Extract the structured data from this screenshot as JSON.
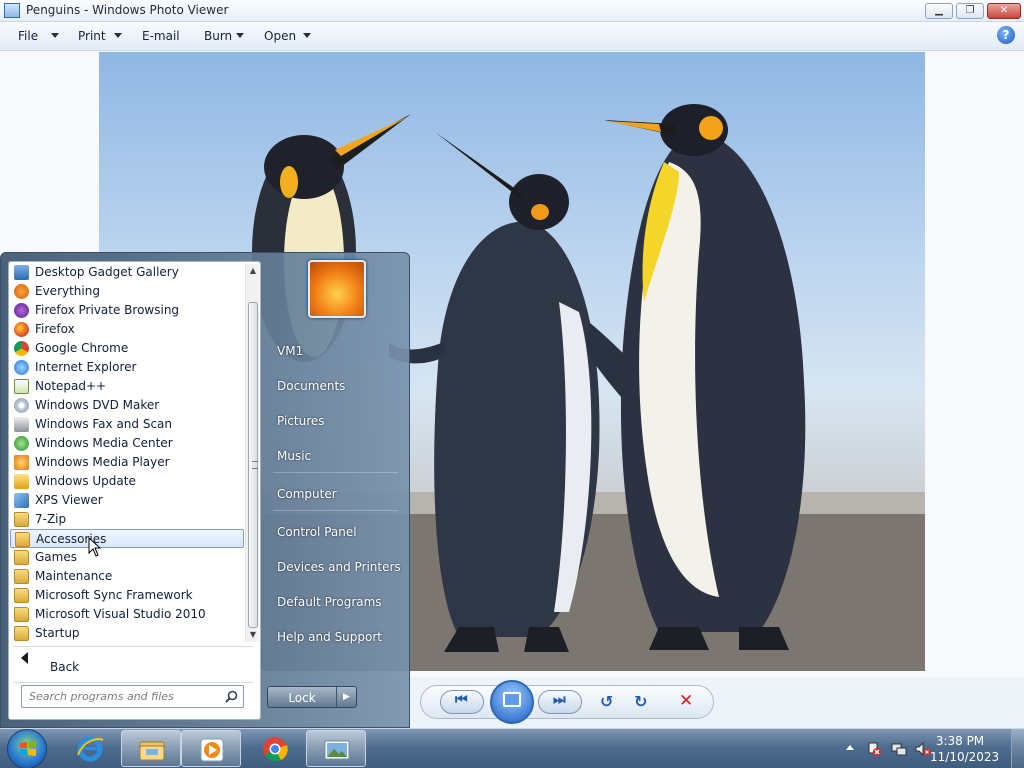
{
  "window": {
    "title": "Penguins - Windows Photo Viewer",
    "minimize_icon": "minimize-icon",
    "maximize_icon": "restore-icon",
    "close_icon": "close-icon"
  },
  "menubar": {
    "items": [
      {
        "label": "File",
        "has_dropdown": true
      },
      {
        "label": "Print",
        "has_dropdown": true
      },
      {
        "label": "E-mail",
        "has_dropdown": false
      },
      {
        "label": "Burn",
        "has_dropdown": true
      },
      {
        "label": "Open",
        "has_dropdown": true
      }
    ],
    "help": "?"
  },
  "viewer": {
    "image_subject": "penguins-photo",
    "controls": [
      "previous-icon",
      "slideshow-icon",
      "next-icon",
      "rotate-counterclockwise-icon",
      "rotate-clockwise-icon",
      "delete-icon"
    ]
  },
  "start_menu": {
    "programs": [
      {
        "label": "Desktop Gadget Gallery",
        "icon": "gadget-icon",
        "selected": false
      },
      {
        "label": "Everything",
        "icon": "everything-search-icon",
        "selected": false
      },
      {
        "label": "Firefox Private Browsing",
        "icon": "firefox-private-icon",
        "selected": false
      },
      {
        "label": "Firefox",
        "icon": "firefox-icon",
        "selected": false
      },
      {
        "label": "Google Chrome",
        "icon": "chrome-icon",
        "selected": false
      },
      {
        "label": "Internet Explorer",
        "icon": "internet-explorer-icon",
        "selected": false
      },
      {
        "label": "Notepad++",
        "icon": "notepadpp-icon",
        "selected": false
      },
      {
        "label": "Windows DVD Maker",
        "icon": "dvd-maker-icon",
        "selected": false
      },
      {
        "label": "Windows Fax and Scan",
        "icon": "fax-scan-icon",
        "selected": false
      },
      {
        "label": "Windows Media Center",
        "icon": "media-center-icon",
        "selected": false
      },
      {
        "label": "Windows Media Player",
        "icon": "media-player-icon",
        "selected": false
      },
      {
        "label": "Windows Update",
        "icon": "windows-update-icon",
        "selected": false
      },
      {
        "label": "XPS Viewer",
        "icon": "xps-viewer-icon",
        "selected": false
      },
      {
        "label": "7-Zip",
        "icon": "folder-icon",
        "selected": false
      },
      {
        "label": "Accessories",
        "icon": "folder-icon",
        "selected": true
      },
      {
        "label": "Games",
        "icon": "folder-icon",
        "selected": false
      },
      {
        "label": "Maintenance",
        "icon": "folder-icon",
        "selected": false
      },
      {
        "label": "Microsoft Sync Framework",
        "icon": "folder-icon",
        "selected": false
      },
      {
        "label": "Microsoft Visual Studio 2010",
        "icon": "folder-icon",
        "selected": false
      },
      {
        "label": "Startup",
        "icon": "folder-icon",
        "selected": false
      }
    ],
    "back_label": "Back",
    "search_placeholder": "Search programs and files",
    "right_items": [
      "VM1",
      "Documents",
      "Pictures",
      "Music",
      "Computer",
      "Control Panel",
      "Devices and Printers",
      "Default Programs",
      "Help and Support"
    ],
    "lock_label": "Lock"
  },
  "taskbar": {
    "pinned": [
      "internet-explorer-icon",
      "windows-explorer-icon",
      "media-player-icon",
      "chrome-icon",
      "photo-viewer-icon"
    ],
    "clock_time": "3:38 PM",
    "clock_date": "11/10/2023",
    "tray_icons": [
      "action-center-icon",
      "network-icon",
      "volume-muted-icon"
    ]
  },
  "colors": {
    "selection": "#d7e8fb",
    "start_menu": "#3c546e",
    "taskbar": "#4f6d8f",
    "delete": "#d01e1e"
  }
}
